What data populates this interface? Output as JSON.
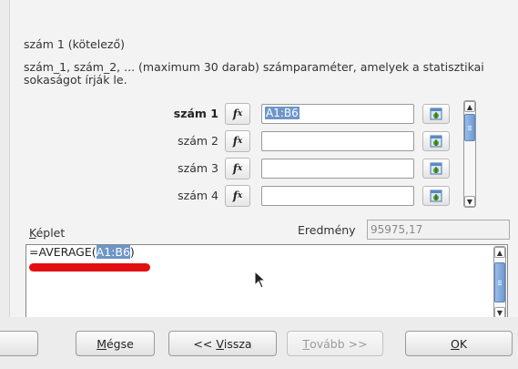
{
  "param_title": "szám 1 (kötelező)",
  "param_desc": "szám_1, szám_2, ... (maximum 30 darab) számparaméter, amelyek a statisztikai sokaságot írják le.",
  "rows": [
    {
      "label": "szám 1",
      "value": "A1:B6",
      "active": true
    },
    {
      "label": "szám 2",
      "value": ""
    },
    {
      "label": "szám 3",
      "value": ""
    },
    {
      "label": "szám 4",
      "value": ""
    }
  ],
  "fx_icon": "fx-icon",
  "shrink_icon": "shrink-icon",
  "formula": {
    "label_underlined": "K",
    "label_rest": "éplet",
    "prefix": "=AVERAGE(",
    "selected": "A1:B6",
    "suffix": ")"
  },
  "result": {
    "label": "Eredmény",
    "value": "95975,17"
  },
  "buttons": {
    "cancel": {
      "underlined": "M",
      "rest": "égse"
    },
    "back": {
      "before": "<< ",
      "underlined": "V",
      "rest": "issza"
    },
    "next": {
      "underlined": "T",
      "rest": "ovább >>"
    },
    "ok": {
      "underlined": "O",
      "rest": "K"
    }
  },
  "colors": {
    "selection": "#6d96c9",
    "redmark": "#e01010",
    "scroll_thumb": "#7aa5da"
  }
}
